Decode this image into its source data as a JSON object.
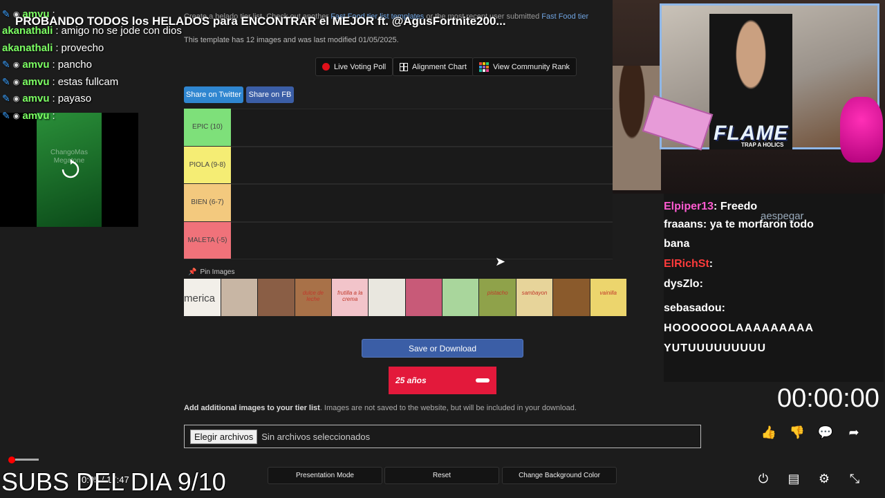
{
  "video": {
    "title": "PROBANDO TODOS los HELADOS para ENCONTRAR el MEJOR ft. @AgusFortnite200...",
    "subs_overlay": "SUBS DEL DIA 9/10",
    "timecode": "0:05 / 17:47",
    "timer": "00:00:00"
  },
  "page": {
    "intro_prefix": "Create a helado tier list. Check out another ",
    "intro_link": "Fast Food tier list templates",
    "intro_mid": " or the most recent user submitted ",
    "intro_link2": "Fast Food tier",
    "modified": "This template has 12 images and was last modified 01/05/2025.",
    "buttons": {
      "live_poll": "Live Voting Poll",
      "alignment": "Alignment Chart",
      "community": "View Community Rank"
    },
    "share": {
      "twitter": "Share on Twitter",
      "fb": "Share on FB"
    },
    "tiers": [
      {
        "label": "EPIC (10)",
        "color": "#7ee07a"
      },
      {
        "label": "PIOLA (9-8)",
        "color": "#f5ed74"
      },
      {
        "label": "BIEN (6-7)",
        "color": "#f3c97e"
      },
      {
        "label": "MALETA (-5)",
        "color": "#f0727a"
      }
    ],
    "pin_images": "Pin Images",
    "images": [
      {
        "caption": "merica",
        "color": "#f2efe9"
      },
      {
        "caption": "",
        "color": "#c8b6a4"
      },
      {
        "caption": "",
        "color": "#8a5e45"
      },
      {
        "caption": "dulce de leche",
        "color": "#a87148"
      },
      {
        "caption": "frutilla a la crema",
        "color": "#f2c4ca"
      },
      {
        "caption": "",
        "color": "#e9e7df"
      },
      {
        "caption": "",
        "color": "#c85a78"
      },
      {
        "caption": "",
        "color": "#a9d69c"
      },
      {
        "caption": "pistacho",
        "color": "#8fa24a"
      },
      {
        "caption": "sambayon",
        "color": "#e7d49a"
      },
      {
        "caption": "",
        "color": "#8a5a2c"
      },
      {
        "caption": "vainilla",
        "color": "#ecd56d"
      }
    ],
    "save": "Save or Download",
    "ad_text": "25 años",
    "add_bold": "Add additional images to your tier list",
    "add_rest": ". Images are not saved to the website, but will be included in your download.",
    "file_button": "Elegir archivos",
    "file_status": "Sin archivos seleccionados",
    "bottom": {
      "presentation": "Presentation Mode",
      "reset": "Reset",
      "bg": "Change Background Color"
    }
  },
  "chat": [
    {
      "user": "amvu",
      "msg": "",
      "badge": true
    },
    {
      "user": "akanathali",
      "msg": "amigo no se jode con dios",
      "badge": false
    },
    {
      "user": "akanathali",
      "msg": "provecho",
      "badge": false
    },
    {
      "user": "amvu",
      "msg": "pancho",
      "badge": true
    },
    {
      "user": "amvu",
      "msg": "estas fullcam",
      "badge": true
    },
    {
      "user": "amvu",
      "msg": "payaso",
      "badge": true
    },
    {
      "user": "amvu",
      "msg": "",
      "badge": true
    }
  ],
  "mini_watermark": "ChangoMas Megatone",
  "cam": {
    "flame": "FLAME",
    "flame_sub": "TRAP A HOLICS"
  },
  "right_chat": [
    {
      "user": "Elpiper13",
      "msg": "Freedo"
    },
    {
      "user": "fraaans",
      "msg": "ya te morfaron todo"
    },
    {
      "user": "",
      "msg": "bana"
    },
    {
      "user": "ElRichSt",
      "msg": ""
    },
    {
      "user": "dysZlo",
      "msg": ""
    },
    {
      "user": "sebasadou",
      "msg": ""
    },
    {
      "user": "",
      "msg": "HOOOOOOLAAAAAAAAA"
    },
    {
      "user": "",
      "msg": "YUTUUUUUUUUU"
    }
  ],
  "right_chat_extra": "aespegar"
}
